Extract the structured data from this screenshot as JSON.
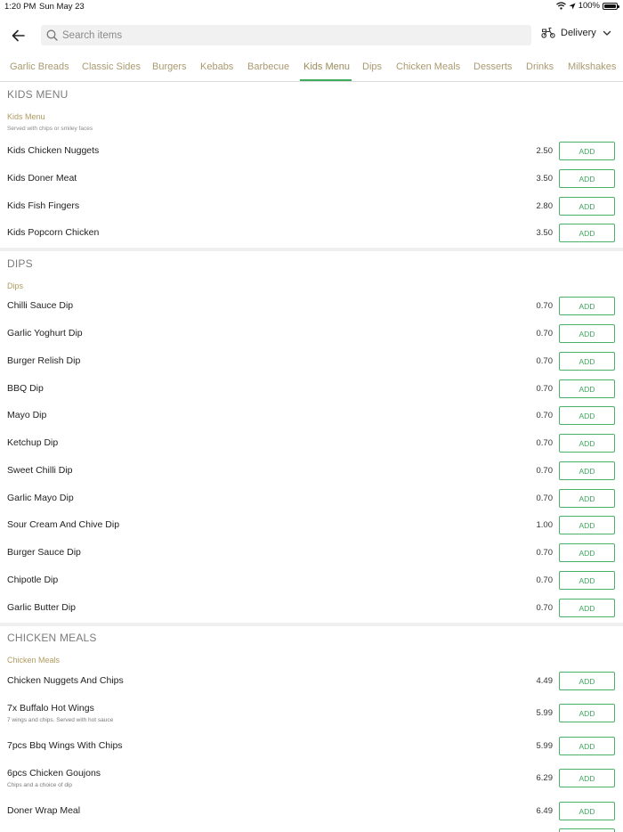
{
  "status_bar": {
    "time": "1:20 PM",
    "date": "Sun May 23",
    "battery": "100%"
  },
  "header": {
    "search_placeholder": "Search items",
    "delivery_label": "Delivery"
  },
  "tabs": [
    "Garlic Breads",
    "Classic Sides",
    "Burgers",
    "Kebabs",
    "Barbecue",
    "Kids Menu",
    "Dips",
    "Chicken Meals",
    "Desserts",
    "Drinks",
    "Milkshakes"
  ],
  "active_tab": "Kids Menu",
  "add_label": "ADD",
  "sections": [
    {
      "title": "KIDS MENU",
      "subcategory": "Kids Menu",
      "subcategory_desc": "Served with chips or smiley faces",
      "items": [
        {
          "name": "Kids Chicken Nuggets",
          "price": "2.50"
        },
        {
          "name": "Kids Doner Meat",
          "price": "3.50"
        },
        {
          "name": "Kids Fish Fingers",
          "price": "2.80"
        },
        {
          "name": "Kids Popcorn Chicken",
          "price": "3.50"
        }
      ]
    },
    {
      "title": "DIPS",
      "subcategory": "Dips",
      "items": [
        {
          "name": "Chilli Sauce Dip",
          "price": "0.70"
        },
        {
          "name": "Garlic Yoghurt Dip",
          "price": "0.70"
        },
        {
          "name": "Burger Relish Dip",
          "price": "0.70"
        },
        {
          "name": "BBQ Dip",
          "price": "0.70"
        },
        {
          "name": "Mayo Dip",
          "price": "0.70"
        },
        {
          "name": "Ketchup Dip",
          "price": "0.70"
        },
        {
          "name": "Sweet Chilli Dip",
          "price": "0.70"
        },
        {
          "name": "Garlic Mayo Dip",
          "price": "0.70"
        },
        {
          "name": "Sour Cream And Chive Dip",
          "price": "1.00"
        },
        {
          "name": "Burger Sauce Dip",
          "price": "0.70"
        },
        {
          "name": "Chipotle Dip",
          "price": "0.70"
        },
        {
          "name": "Garlic Butter Dip",
          "price": "0.70"
        }
      ]
    },
    {
      "title": "CHICKEN MEALS",
      "subcategory": "Chicken Meals",
      "items": [
        {
          "name": "Chicken Nuggets And Chips",
          "price": "4.49"
        },
        {
          "name": "7x Buffalo Hot Wings",
          "desc": "7 wings and chips. Served with hot sauce",
          "price": "5.99"
        },
        {
          "name": "7pcs Bbq Wings With Chips",
          "price": "5.99"
        },
        {
          "name": "6pcs Chicken Goujons",
          "desc": "Chips and a choice of dip",
          "price": "6.29"
        },
        {
          "name": "Doner Wrap Meal",
          "price": "6.49"
        }
      ]
    }
  ]
}
